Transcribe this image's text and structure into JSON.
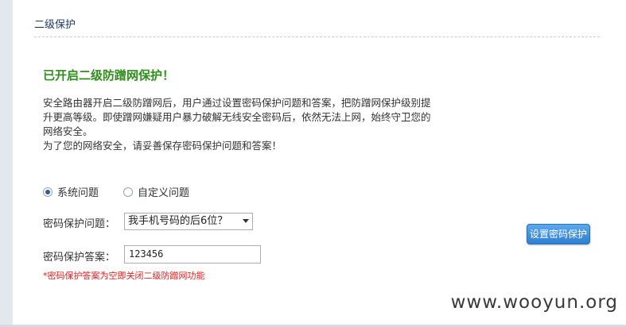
{
  "section": {
    "title": "二级保护"
  },
  "status": {
    "heading": "已开启二级防蹭网保护！"
  },
  "description": {
    "line1": "安全路由器开启二级防蹭网后，用户通过设置密码保护问题和答案，把防蹭网保护级别提",
    "line2": "升更高等级。即使蹭网嫌疑用户暴力破解无线安全密码后，依然无法上网，始终守卫您的",
    "line3": "网络安全。",
    "line4": "为了您的网络安全，请妥善保存密码保护问题和答案！"
  },
  "question_type": {
    "options": [
      {
        "label": "系统问题",
        "checked": true
      },
      {
        "label": "自定义问题",
        "checked": false
      }
    ]
  },
  "form": {
    "question_label": "密码保护问题：",
    "question_value": "我手机号码的后6位？",
    "answer_label": "密码保护答案：",
    "answer_value": "123456",
    "note": "*密码保护答案为空即关闭二级防蹭网功能",
    "submit_label": "设置密码保护"
  },
  "watermark": {
    "text": "www.wooyun.org"
  },
  "colors": {
    "heading": "#2f8f1b",
    "note": "#e02020",
    "button": "#2f7fd2",
    "title": "#1f3a63"
  }
}
